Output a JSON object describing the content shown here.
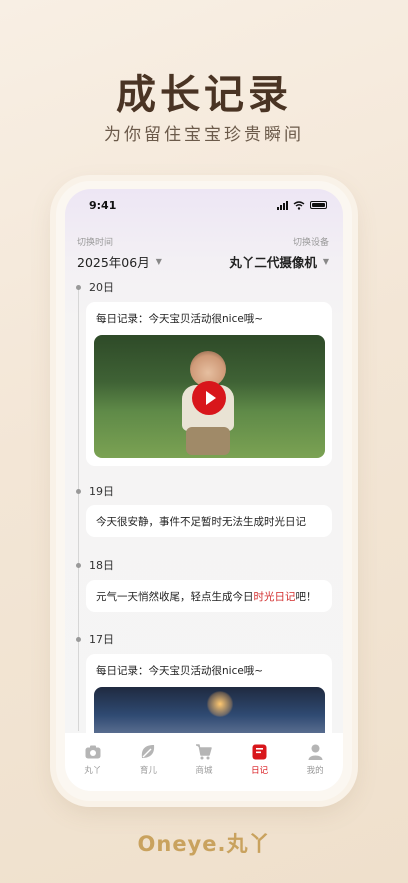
{
  "hero": {
    "title": "成长记录",
    "subtitle": "为你留住宝宝珍贵瞬间"
  },
  "status_bar": {
    "time": "9:41"
  },
  "filters": {
    "time_label": "切换时间",
    "time_value": "2025年06月",
    "device_label": "切换设备",
    "device_value": "丸丫二代摄像机"
  },
  "timeline": [
    {
      "day": "20日",
      "text": "每日记录：今天宝贝活动很nice哦~",
      "has_video": true
    },
    {
      "day": "19日",
      "text": "今天很安静，事件不足暂时无法生成时光日记"
    },
    {
      "day": "18日",
      "text_before": "元气一天悄然收尾，轻点生成今日",
      "link": "时光日记",
      "text_after": "吧！"
    },
    {
      "day": "17日",
      "text": "每日记录：今天宝贝活动很nice哦~",
      "has_video": true
    }
  ],
  "tabbar": [
    {
      "label": "丸丫",
      "icon": "camera-icon",
      "active": false
    },
    {
      "label": "育儿",
      "icon": "leaf-icon",
      "active": false
    },
    {
      "label": "商城",
      "icon": "cart-icon",
      "active": false
    },
    {
      "label": "日记",
      "icon": "diary-icon",
      "active": true
    },
    {
      "label": "我的",
      "icon": "person-icon",
      "active": false
    }
  ],
  "colors": {
    "accent": "#d8161b",
    "hero_text": "#4a3424",
    "logo": "#c9a25e"
  },
  "footer": {
    "logo_text": "Oneye.丸丫"
  }
}
